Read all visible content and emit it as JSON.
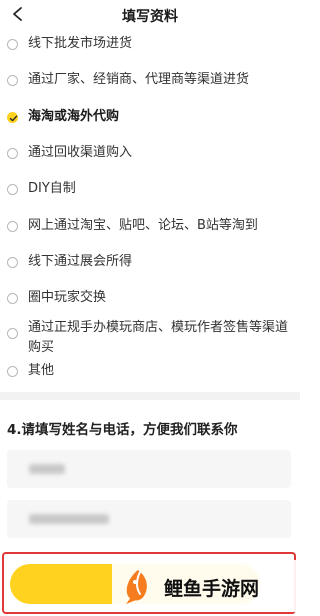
{
  "header": {
    "title": "填写资料"
  },
  "question3": {
    "options": [
      {
        "label": "线下批发市场进货",
        "selected": false
      },
      {
        "label": "通过厂家、经销商、代理商等渠道进货",
        "selected": false
      },
      {
        "label": "海淘或海外代购",
        "selected": true
      },
      {
        "label": "通过回收渠道购入",
        "selected": false
      },
      {
        "label": "DIY自制",
        "selected": false
      },
      {
        "label": "网上通过淘宝、贴吧、论坛、B站等淘到",
        "selected": false
      },
      {
        "label": "线下通过展会所得",
        "selected": false
      },
      {
        "label": "圈中玩家交换",
        "selected": false
      },
      {
        "label": "通过正规手办模玩商店、模玩作者签售等渠道购买",
        "selected": false
      },
      {
        "label": "其他",
        "selected": false
      }
    ]
  },
  "question4": {
    "title": "4.请填写姓名与电话，方便我们联系你",
    "name_field": {
      "value": "",
      "placeholder": ""
    },
    "phone_field": {
      "value": "",
      "placeholder": ""
    }
  },
  "submit": {
    "label": ""
  },
  "watermark": {
    "text": "鲤鱼手游网"
  },
  "colors": {
    "accent": "#FFD21F",
    "highlight_border": "#e03838",
    "divider": "#f2f2f2"
  },
  "icons": {
    "back": "chevron-left-icon",
    "check": "check-icon",
    "logo": "fish-logo-icon"
  }
}
